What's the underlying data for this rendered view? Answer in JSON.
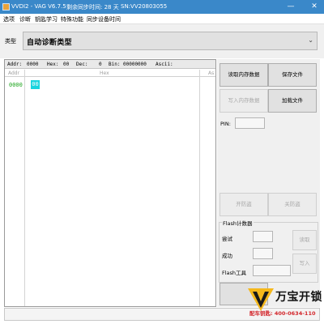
{
  "window": {
    "title": "VVDI2 - VAG V6.7.5",
    "sync_time": "剩余同步时间: 28 天",
    "serial": "SN:VV20803055",
    "minimize_glyph": "—",
    "close_glyph": "✕"
  },
  "menu": [
    "选项",
    "诊断",
    "钥匙学习",
    "特殊功能",
    "同步设备时间"
  ],
  "type_selector": {
    "label": "类型",
    "value": "自动诊断类型",
    "arrow_glyph": "⌄"
  },
  "hex_view": {
    "info": {
      "addr_label": "Addr:",
      "addr_value": "0000",
      "hex_label": "Hex:",
      "hex_value": "00",
      "dec_label": "Dec:",
      "dec_value": "0",
      "bin_label": "Bin:",
      "bin_value": "00000000",
      "ascii_label": "Ascii:"
    },
    "header": {
      "addr": "Addr",
      "hex": "Hex",
      "ascii": "As"
    },
    "rows": [
      {
        "addr": "0000",
        "bytes": [
          "00"
        ]
      }
    ]
  },
  "buttons": {
    "read_memory": "读取内存数据",
    "save_file": "保存文件",
    "write_memory": "写入内存数据",
    "load_file": "加载文件",
    "unlock": "开防盗",
    "lock": "关防盗"
  },
  "pin": {
    "label": "PIN:",
    "value": ""
  },
  "flash_counter": {
    "title": "Flash计数器",
    "try_label": "尝试",
    "success_label": "成功",
    "tool_label": "Flash工具",
    "read_button": "读取",
    "write_button": "写入"
  },
  "logo": {
    "name": "万宝开锁",
    "hotline": "配车钥匙: 400-0634-110",
    "colors": {
      "mark_yellow": "#f5b81b",
      "mark_black": "#1a1a1a",
      "hotline_red": "#d3262b"
    }
  },
  "colors": {
    "titlebar": "#3a88c9",
    "hex_cursor": "#19d4de",
    "addr_green": "#1ea51e"
  }
}
